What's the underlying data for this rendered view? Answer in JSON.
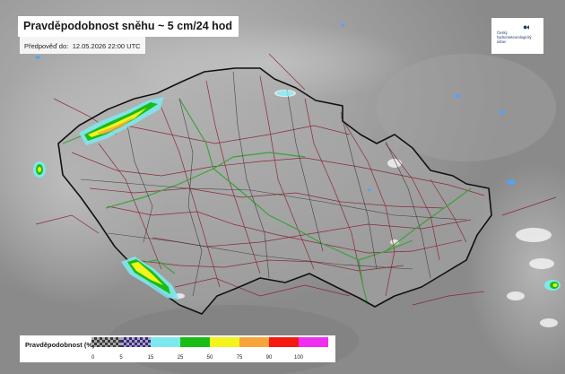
{
  "title": "Pravděpodobnost sněhu ~ 5 cm/24 hod",
  "forecast": {
    "label": "Předpověď do:",
    "value": "12.05.2026 22:00 UTC"
  },
  "logo": {
    "mark": "●◐",
    "lines": [
      "Český",
      "hydrometeorologický",
      "ústav"
    ]
  },
  "legend": {
    "title": "Pravděpodobnost (%)",
    "bins": [
      {
        "value": "0",
        "color": "checker-gray"
      },
      {
        "value": "5",
        "color": "checker-purple"
      },
      {
        "value": "15",
        "color": "#7de8ee"
      },
      {
        "value": "25",
        "color": "#19bd16"
      },
      {
        "value": "50",
        "color": "#f3f31e"
      },
      {
        "value": "75",
        "color": "#f7a43a"
      },
      {
        "value": "90",
        "color": "#f41a12"
      },
      {
        "value": "100",
        "color": "#ee2ff0"
      }
    ]
  },
  "colors": {
    "border": "#111111",
    "regions": "#2a2a2a",
    "roads": "#8a1d2c",
    "highways": "#3aa33a",
    "water": "#4fa3ff"
  }
}
